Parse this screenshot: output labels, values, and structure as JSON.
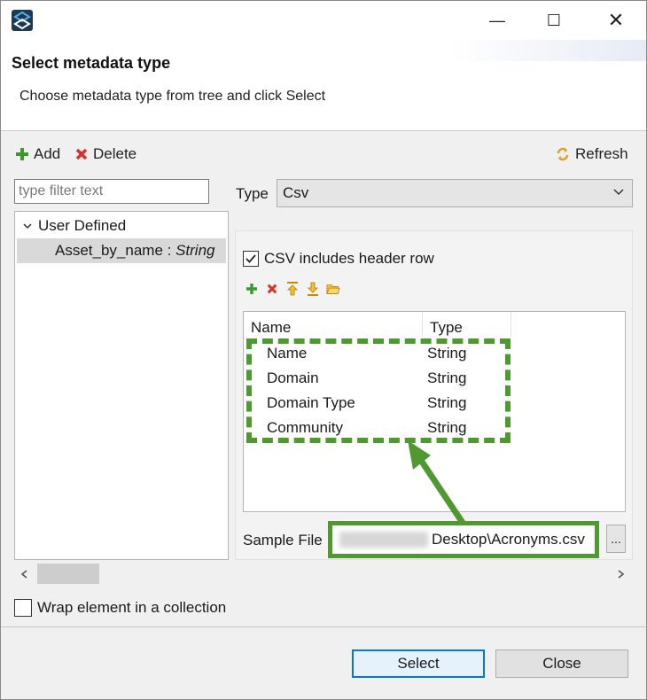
{
  "window": {
    "minimize_glyph": "—",
    "maximize_glyph": "☐",
    "close_glyph": "✕"
  },
  "header": {
    "title": "Select metadata type",
    "description": "Choose metadata type from tree and click Select"
  },
  "toolbar": {
    "add_label": "Add",
    "delete_label": "Delete",
    "refresh_label": "Refresh"
  },
  "filter": {
    "placeholder": "type filter text",
    "value": ""
  },
  "tree": {
    "group_label": "User Defined",
    "child_name": "Asset_by_name",
    "child_sep": " : ",
    "child_type": "String"
  },
  "type_selector": {
    "label": "Type",
    "value": "Csv"
  },
  "csv": {
    "header_row_label": "CSV includes header row",
    "header_row_checked": true,
    "columns": [
      {
        "header": "Name"
      },
      {
        "header": "Type"
      }
    ],
    "rows": [
      {
        "name": "Name",
        "type": "String"
      },
      {
        "name": "Domain",
        "type": "String"
      },
      {
        "name": "Domain Type",
        "type": "String"
      },
      {
        "name": "Community",
        "type": "String"
      }
    ],
    "sample_file_label": "Sample File",
    "sample_file_value": "Desktop\\Acronyms.csv",
    "browse_label": "..."
  },
  "wrap": {
    "label": "Wrap element in a collection",
    "checked": false
  },
  "buttons": {
    "select_label": "Select",
    "close_label": "Close"
  },
  "colors": {
    "highlight": "#4f9a30",
    "accent": "#0078d7"
  }
}
